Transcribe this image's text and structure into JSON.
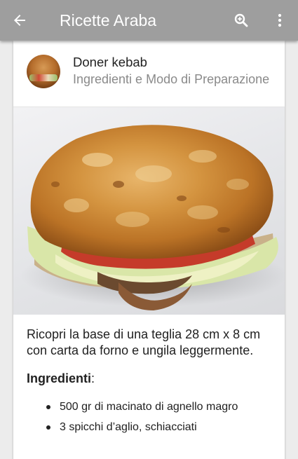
{
  "app_bar": {
    "title": "Ricette Araba",
    "back_icon": "arrow-back-icon",
    "search_icon": "zoom-in-icon",
    "more_icon": "more-vertical-icon",
    "background": "#9e9e9e"
  },
  "recipe": {
    "title": "Doner kebab",
    "subtitle": "Ingredienti e Modo di Preparazione",
    "description": "Ricopri la base di una teglia 28 cm x 8 cm con carta da forno e ungila leggermente.",
    "ingredients_heading": "Ingredienti",
    "ingredients_colon": ":",
    "ingredients": [
      "500 gr di macinato di agnello magro",
      "3 spicchi d’aglio, schiacciati"
    ]
  }
}
